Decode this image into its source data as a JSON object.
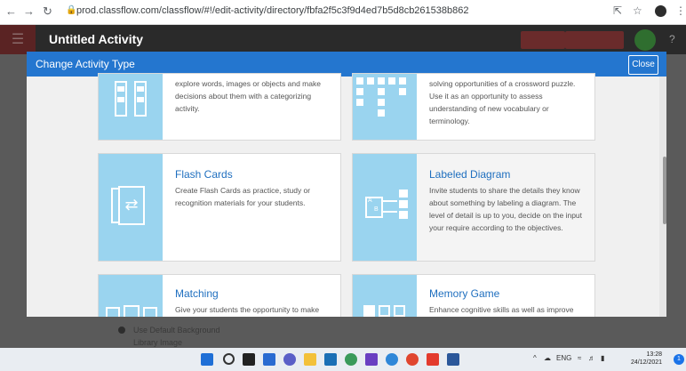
{
  "browser": {
    "url": "prod.classflow.com/classflow/#!/edit-activity/directory/fbfa2f5c3f9d4ed7b5d8cb261538b862"
  },
  "app": {
    "title": "Untitled Activity"
  },
  "modal": {
    "title": "Change Activity Type",
    "close_label": "Close",
    "cards": [
      {
        "title": "",
        "description": "explore words, images or objects and make decisions about them with a categorizing activity."
      },
      {
        "title": "",
        "description": "solving opportunities of a crossword puzzle. Use it as an opportunity to assess understanding of new vocabulary or terminology."
      },
      {
        "title": "Flash Cards",
        "description": "Create Flash Cards as practice, study or recognition materials for your students."
      },
      {
        "title": "Labeled Diagram",
        "description": "Invite students to share the details they know about something by labeling a diagram. The level of detail is up to you, decide on the input your require according to the objectives."
      },
      {
        "title": "Matching",
        "description": "Give your students the opportunity to make"
      },
      {
        "title": "Memory Game",
        "description": "Enhance cognitive skills as well as improve"
      }
    ]
  },
  "page_options": {
    "use_default_background": "Use Default Background",
    "library_image": "Library Image"
  },
  "taskbar": {
    "language": "ENG",
    "time": "13:28",
    "date": "24/12/2021",
    "notification_count": "1"
  },
  "colors": {
    "modal_header": "#2476cf",
    "card_icon_bg": "#9ad4ef",
    "card_title": "#1f6fbf"
  }
}
